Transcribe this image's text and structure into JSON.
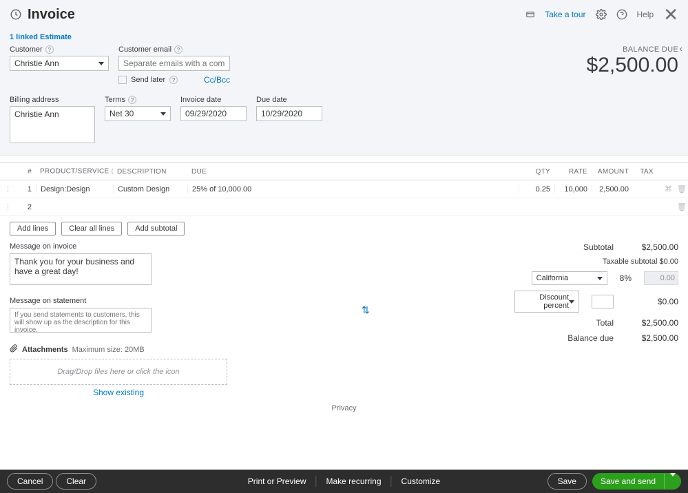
{
  "header": {
    "title": "Invoice",
    "take_tour": "Take a tour",
    "help": "Help"
  },
  "linked_text": "1 linked Estimate",
  "balance": {
    "label": "BALANCE DUE",
    "amount": "$2,500.00"
  },
  "customer": {
    "label": "Customer",
    "value": "Christie Ann"
  },
  "customer_email": {
    "label": "Customer email",
    "placeholder": "Separate emails with a comma",
    "send_later": "Send later",
    "ccbcc": "Cc/Bcc"
  },
  "billing": {
    "label": "Billing address",
    "value": "Christie Ann"
  },
  "terms": {
    "label": "Terms",
    "value": "Net 30"
  },
  "invoice_date": {
    "label": "Invoice date",
    "value": "09/29/2020"
  },
  "due_date": {
    "label": "Due date",
    "value": "10/29/2020"
  },
  "grid": {
    "headers": {
      "num": "#",
      "prod": "PRODUCT/SERVICE",
      "desc": "DESCRIPTION",
      "due": "DUE",
      "qty": "QTY",
      "rate": "RATE",
      "amount": "AMOUNT",
      "tax": "TAX"
    },
    "rows": [
      {
        "num": "1",
        "prod": "Design:Design",
        "desc": "Custom Design",
        "due": "25% of 10,000.00",
        "qty": "0.25",
        "rate": "10,000",
        "amount": "2,500.00"
      },
      {
        "num": "2",
        "prod": "",
        "desc": "",
        "due": "",
        "qty": "",
        "rate": "",
        "amount": ""
      }
    ]
  },
  "line_buttons": {
    "add": "Add lines",
    "clear": "Clear all lines",
    "subtotal": "Add subtotal"
  },
  "msg_invoice": {
    "label": "Message on invoice",
    "value": "Thank you for your business and have a great day!"
  },
  "msg_statement": {
    "label": "Message on statement",
    "placeholder": "If you send statements to customers, this will show up as the description for this invoice."
  },
  "totals": {
    "subtotal_lbl": "Subtotal",
    "subtotal_val": "$2,500.00",
    "taxable_lbl": "Taxable subtotal $0.00",
    "tax_state": "California",
    "tax_pct": "8%",
    "tax_val": "0.00",
    "discount_lbl": "Discount percent",
    "discount_val": "$0.00",
    "total_lbl": "Total",
    "total_val": "$2,500.00",
    "balance_lbl": "Balance due",
    "balance_val": "$2,500.00"
  },
  "attachments": {
    "label": "Attachments",
    "max": "Maximum size: 20MB",
    "drop": "Drag/Drop files here or click the icon",
    "show": "Show existing"
  },
  "privacy": "Privacy",
  "footer": {
    "cancel": "Cancel",
    "clear": "Clear",
    "print": "Print or Preview",
    "recurring": "Make recurring",
    "customize": "Customize",
    "save": "Save",
    "save_send": "Save and send"
  }
}
